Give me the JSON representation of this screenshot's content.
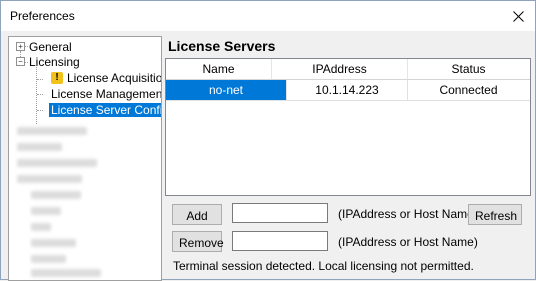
{
  "window": {
    "title": "Preferences",
    "close_icon": "close-icon"
  },
  "tree": {
    "general": {
      "expander": "+",
      "label": "General"
    },
    "licensing": {
      "expander": "−",
      "label": "Licensing"
    },
    "children": [
      {
        "label": "License Acquisition",
        "icon": "warning-icon",
        "icon_glyph": "!"
      },
      {
        "label": "License Management"
      },
      {
        "label": "License Server Configu"
      }
    ]
  },
  "section_title": "License Servers",
  "table": {
    "headers": [
      "Name",
      "IPAddress",
      "Status"
    ],
    "rows": [
      {
        "name": "no-net",
        "ip": "10.1.14.223",
        "status": "Connected"
      }
    ]
  },
  "form": {
    "add_label": "Add",
    "remove_label": "Remove",
    "refresh_label": "Refresh",
    "add_value": "",
    "remove_value": "",
    "add_hint": "(IPAddress or Host Name)",
    "remove_hint": "(IPAddress or Host Name)"
  },
  "status_message": "Terminal session detected. Local licensing not permitted."
}
